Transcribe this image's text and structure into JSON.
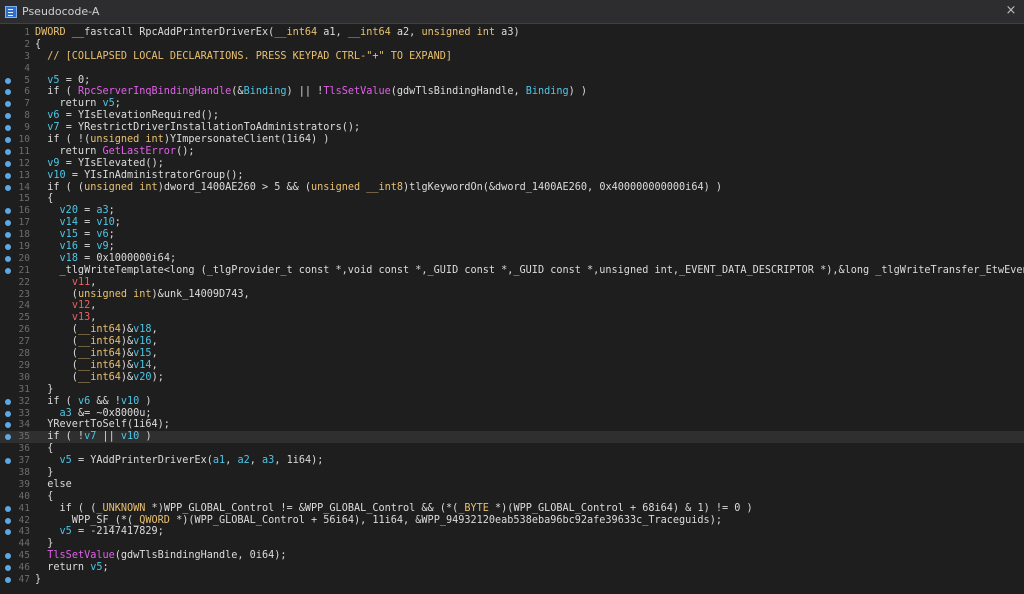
{
  "window": {
    "title": "Pseudocode-A",
    "close_glyph": "×",
    "tab_icon": "pseudocode-document-icon"
  },
  "colors": {
    "background": "#1e1e1e",
    "line_numbers": "#6d6d6d",
    "breakpoint_dot": "#5aa9e6",
    "local_var": "#4cc7e6",
    "import_fn": "#e060e8",
    "type_keyword": "#e8c070",
    "highlight_line": "#2f2f2f"
  },
  "code": {
    "highlighted_line": 35,
    "lines": [
      {
        "n": "1",
        "bp": false,
        "tokens": [
          [
            "ty",
            "DWORD"
          ],
          [
            "pl",
            " __fastcall RpcAddPrinterDriverEx("
          ],
          [
            "ty",
            "__int64"
          ],
          [
            "pl",
            " a1, "
          ],
          [
            "ty",
            "__int64"
          ],
          [
            "pl",
            " a2, "
          ],
          [
            "ty",
            "unsigned int"
          ],
          [
            "pl",
            " a3)"
          ]
        ]
      },
      {
        "n": "2",
        "bp": false,
        "tokens": [
          [
            "pl",
            "{"
          ]
        ]
      },
      {
        "n": "3",
        "bp": false,
        "tokens": [
          [
            "cm",
            "  // [COLLAPSED LOCAL DECLARATIONS. PRESS KEYPAD CTRL-\"+\" TO EXPAND]"
          ]
        ]
      },
      {
        "n": "4",
        "bp": false,
        "tokens": [
          [
            "pl",
            ""
          ]
        ]
      },
      {
        "n": "5",
        "bp": true,
        "tokens": [
          [
            "pl",
            "  "
          ],
          [
            "lv",
            "v5"
          ],
          [
            "pl",
            " = 0;"
          ]
        ]
      },
      {
        "n": "6",
        "bp": true,
        "tokens": [
          [
            "pl",
            "  if ( "
          ],
          [
            "imp",
            "RpcServerInqBindingHandle"
          ],
          [
            "pl",
            "(&"
          ],
          [
            "lv",
            "Binding"
          ],
          [
            "pl",
            ") || !"
          ],
          [
            "imp",
            "TlsSetValue"
          ],
          [
            "pl",
            "(gdwTlsBindingHandle, "
          ],
          [
            "lv",
            "Binding"
          ],
          [
            "pl",
            ") )"
          ]
        ]
      },
      {
        "n": "7",
        "bp": true,
        "tokens": [
          [
            "pl",
            "    return "
          ],
          [
            "lv",
            "v5"
          ],
          [
            "pl",
            ";"
          ]
        ]
      },
      {
        "n": "8",
        "bp": true,
        "tokens": [
          [
            "pl",
            "  "
          ],
          [
            "lv",
            "v6"
          ],
          [
            "pl",
            " = YIsElevationRequired();"
          ]
        ]
      },
      {
        "n": "9",
        "bp": true,
        "tokens": [
          [
            "pl",
            "  "
          ],
          [
            "lv",
            "v7"
          ],
          [
            "pl",
            " = YRestrictDriverInstallationToAdministrators();"
          ]
        ]
      },
      {
        "n": "10",
        "bp": true,
        "tokens": [
          [
            "pl",
            "  if ( !("
          ],
          [
            "ty",
            "unsigned int"
          ],
          [
            "pl",
            ")YImpersonateClient(1i64) )"
          ]
        ]
      },
      {
        "n": "11",
        "bp": true,
        "tokens": [
          [
            "pl",
            "    return "
          ],
          [
            "imp",
            "GetLastError"
          ],
          [
            "pl",
            "();"
          ]
        ]
      },
      {
        "n": "12",
        "bp": true,
        "tokens": [
          [
            "pl",
            "  "
          ],
          [
            "lv",
            "v9"
          ],
          [
            "pl",
            " = YIsElevated();"
          ]
        ]
      },
      {
        "n": "13",
        "bp": true,
        "tokens": [
          [
            "pl",
            "  "
          ],
          [
            "lv",
            "v10"
          ],
          [
            "pl",
            " = YIsInAdministratorGroup();"
          ]
        ]
      },
      {
        "n": "14",
        "bp": true,
        "tokens": [
          [
            "pl",
            "  if ( ("
          ],
          [
            "ty",
            "unsigned int"
          ],
          [
            "pl",
            ")dword_1400AE260 > 5 && ("
          ],
          [
            "ty",
            "unsigned __int8"
          ],
          [
            "pl",
            ")tlgKeywordOn(&dword_1400AE260, 0x400000000000i64) )"
          ]
        ]
      },
      {
        "n": "15",
        "bp": false,
        "tokens": [
          [
            "pl",
            "  {"
          ]
        ]
      },
      {
        "n": "16",
        "bp": true,
        "tokens": [
          [
            "pl",
            "    "
          ],
          [
            "lv",
            "v20"
          ],
          [
            "pl",
            " = "
          ],
          [
            "lv",
            "a3"
          ],
          [
            "pl",
            ";"
          ]
        ]
      },
      {
        "n": "17",
        "bp": true,
        "tokens": [
          [
            "pl",
            "    "
          ],
          [
            "lv",
            "v14"
          ],
          [
            "pl",
            " = "
          ],
          [
            "lv",
            "v10"
          ],
          [
            "pl",
            ";"
          ]
        ]
      },
      {
        "n": "18",
        "bp": true,
        "tokens": [
          [
            "pl",
            "    "
          ],
          [
            "lv",
            "v15"
          ],
          [
            "pl",
            " = "
          ],
          [
            "lv",
            "v6"
          ],
          [
            "pl",
            ";"
          ]
        ]
      },
      {
        "n": "19",
        "bp": true,
        "tokens": [
          [
            "pl",
            "    "
          ],
          [
            "lv",
            "v16"
          ],
          [
            "pl",
            " = "
          ],
          [
            "lv",
            "v9"
          ],
          [
            "pl",
            ";"
          ]
        ]
      },
      {
        "n": "20",
        "bp": true,
        "tokens": [
          [
            "pl",
            "    "
          ],
          [
            "lv",
            "v18"
          ],
          [
            "pl",
            " = 0x1000000i64;"
          ]
        ]
      },
      {
        "n": "21",
        "bp": true,
        "tokens": [
          [
            "pl",
            "    _tlgWriteTemplate<long (_tlgProvider_t const *,void const *,_GUID const *,_GUID const *,unsigned int,_EVENT_DATA_DESCRIPTOR *),&long _tlgWriteTransfer_EtwEventWriteTransfer(_t"
          ]
        ]
      },
      {
        "n": "22",
        "bp": false,
        "tokens": [
          [
            "pl",
            "      "
          ],
          [
            "red",
            "v11"
          ],
          [
            "pl",
            ","
          ]
        ]
      },
      {
        "n": "23",
        "bp": false,
        "tokens": [
          [
            "pl",
            "      ("
          ],
          [
            "ty",
            "unsigned int"
          ],
          [
            "pl",
            ")&unk_14009D743,"
          ]
        ]
      },
      {
        "n": "24",
        "bp": false,
        "tokens": [
          [
            "pl",
            "      "
          ],
          [
            "red",
            "v12"
          ],
          [
            "pl",
            ","
          ]
        ]
      },
      {
        "n": "25",
        "bp": false,
        "tokens": [
          [
            "pl",
            "      "
          ],
          [
            "red",
            "v13"
          ],
          [
            "pl",
            ","
          ]
        ]
      },
      {
        "n": "26",
        "bp": false,
        "tokens": [
          [
            "pl",
            "      ("
          ],
          [
            "ty",
            "__int64"
          ],
          [
            "pl",
            ")&"
          ],
          [
            "lv",
            "v18"
          ],
          [
            "pl",
            ","
          ]
        ]
      },
      {
        "n": "27",
        "bp": false,
        "tokens": [
          [
            "pl",
            "      ("
          ],
          [
            "ty",
            "__int64"
          ],
          [
            "pl",
            ")&"
          ],
          [
            "lv",
            "v16"
          ],
          [
            "pl",
            ","
          ]
        ]
      },
      {
        "n": "28",
        "bp": false,
        "tokens": [
          [
            "pl",
            "      ("
          ],
          [
            "ty",
            "__int64"
          ],
          [
            "pl",
            ")&"
          ],
          [
            "lv",
            "v15"
          ],
          [
            "pl",
            ","
          ]
        ]
      },
      {
        "n": "29",
        "bp": false,
        "tokens": [
          [
            "pl",
            "      ("
          ],
          [
            "ty",
            "__int64"
          ],
          [
            "pl",
            ")&"
          ],
          [
            "lv",
            "v14"
          ],
          [
            "pl",
            ","
          ]
        ]
      },
      {
        "n": "30",
        "bp": false,
        "tokens": [
          [
            "pl",
            "      ("
          ],
          [
            "ty",
            "__int64"
          ],
          [
            "pl",
            ")&"
          ],
          [
            "lv",
            "v20"
          ],
          [
            "pl",
            ");"
          ]
        ]
      },
      {
        "n": "31",
        "bp": false,
        "tokens": [
          [
            "pl",
            "  }"
          ]
        ]
      },
      {
        "n": "32",
        "bp": true,
        "tokens": [
          [
            "pl",
            "  if ( "
          ],
          [
            "lv",
            "v6"
          ],
          [
            "pl",
            " && !"
          ],
          [
            "lv",
            "v10"
          ],
          [
            "pl",
            " )"
          ]
        ]
      },
      {
        "n": "33",
        "bp": true,
        "tokens": [
          [
            "pl",
            "    "
          ],
          [
            "lv",
            "a3"
          ],
          [
            "pl",
            " &= ~0x8000u;"
          ]
        ]
      },
      {
        "n": "34",
        "bp": true,
        "tokens": [
          [
            "pl",
            "  YRevertToSelf(1i64);"
          ]
        ]
      },
      {
        "n": "35",
        "bp": true,
        "tokens": [
          [
            "pl",
            "  if ( !"
          ],
          [
            "lv",
            "v7"
          ],
          [
            "pl",
            " || "
          ],
          [
            "lv",
            "v10"
          ],
          [
            "pl",
            " )"
          ]
        ]
      },
      {
        "n": "36",
        "bp": false,
        "tokens": [
          [
            "pl",
            "  {"
          ]
        ]
      },
      {
        "n": "37",
        "bp": true,
        "tokens": [
          [
            "pl",
            "    "
          ],
          [
            "lv",
            "v5"
          ],
          [
            "pl",
            " = YAddPrinterDriverEx("
          ],
          [
            "lv",
            "a1"
          ],
          [
            "pl",
            ", "
          ],
          [
            "lv",
            "a2"
          ],
          [
            "pl",
            ", "
          ],
          [
            "lv",
            "a3"
          ],
          [
            "pl",
            ", 1i64);"
          ]
        ]
      },
      {
        "n": "38",
        "bp": false,
        "tokens": [
          [
            "pl",
            "  }"
          ]
        ]
      },
      {
        "n": "39",
        "bp": false,
        "tokens": [
          [
            "pl",
            "  else"
          ]
        ]
      },
      {
        "n": "40",
        "bp": false,
        "tokens": [
          [
            "pl",
            "  {"
          ]
        ]
      },
      {
        "n": "41",
        "bp": true,
        "tokens": [
          [
            "pl",
            "    if ( ("
          ],
          [
            "ty",
            "_UNKNOWN"
          ],
          [
            "pl",
            " *)WPP_GLOBAL_Control != &WPP_GLOBAL_Control && (*("
          ],
          [
            "ty",
            "_BYTE"
          ],
          [
            "pl",
            " *)(WPP_GLOBAL_Control + 68i64) & 1) != 0 )"
          ]
        ]
      },
      {
        "n": "42",
        "bp": true,
        "tokens": [
          [
            "pl",
            "      WPP_SF_(*("
          ],
          [
            "ty",
            "_QWORD"
          ],
          [
            "pl",
            " *)(WPP_GLOBAL_Control + 56i64), 11i64, &WPP_94932120eab538eba96bc92afe39633c_Traceguids);"
          ]
        ]
      },
      {
        "n": "43",
        "bp": true,
        "tokens": [
          [
            "pl",
            "    "
          ],
          [
            "lv",
            "v5"
          ],
          [
            "pl",
            " = -2147417829;"
          ]
        ]
      },
      {
        "n": "44",
        "bp": false,
        "tokens": [
          [
            "pl",
            "  }"
          ]
        ]
      },
      {
        "n": "45",
        "bp": true,
        "tokens": [
          [
            "pl",
            "  "
          ],
          [
            "imp",
            "TlsSetValue"
          ],
          [
            "pl",
            "(gdwTlsBindingHandle, 0i64);"
          ]
        ]
      },
      {
        "n": "46",
        "bp": true,
        "tokens": [
          [
            "pl",
            "  return "
          ],
          [
            "lv",
            "v5"
          ],
          [
            "pl",
            ";"
          ]
        ]
      },
      {
        "n": "47",
        "bp": true,
        "tokens": [
          [
            "pl",
            "}"
          ]
        ]
      }
    ]
  }
}
